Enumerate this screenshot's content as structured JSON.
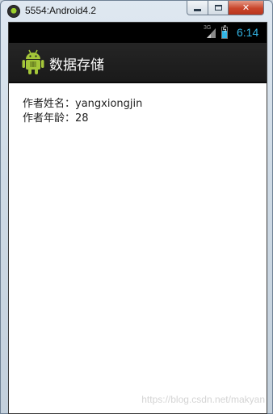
{
  "window": {
    "title": "5554:Android4.2",
    "buttons": {
      "minimize": "minimize-icon",
      "maximize": "maximize-icon",
      "close": "✕"
    }
  },
  "statusbar": {
    "network": "3G",
    "signal_icon": "signal-icon",
    "battery_icon": "battery-charging-icon",
    "time": "6:14",
    "accent_color": "#33b5e5"
  },
  "actionbar": {
    "icon": "android-icon",
    "title": "数据存储"
  },
  "content": {
    "author_name_line": "作者姓名：yangxiongjin",
    "author_age_line": "作者年龄：28"
  },
  "watermark": "https://blog.csdn.net/makyan"
}
